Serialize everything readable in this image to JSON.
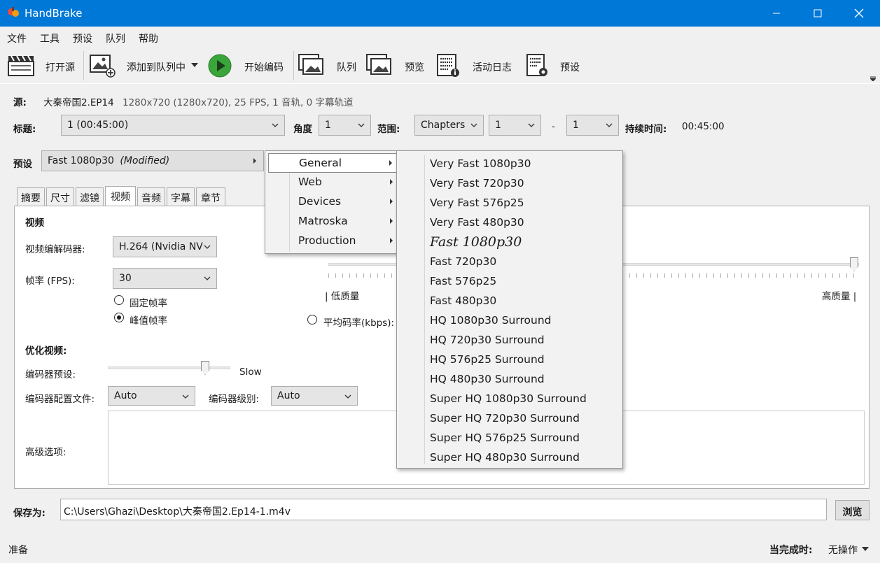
{
  "window": {
    "title": "HandBrake"
  },
  "menu": [
    "文件",
    "工具",
    "预设",
    "队列",
    "帮助"
  ],
  "toolbar": {
    "open_source": "打开源",
    "add_to_queue": "添加到队列中",
    "start_encode": "开始编码",
    "queue": "队列",
    "preview": "预览",
    "activity_log": "活动日志",
    "presets": "预设"
  },
  "source": {
    "label": "源:",
    "name": "大秦帝国2.EP14",
    "info": "1280x720 (1280x720), 25 FPS, 1 音轨, 0 字幕轨道"
  },
  "title_row": {
    "title_label": "标题:",
    "title_value": "1 (00:45:00)",
    "angle_label": "角度",
    "angle_value": "1",
    "range_label": "范围:",
    "range_type": "Chapters",
    "range_start": "1",
    "range_dash": "-",
    "range_end": "1",
    "duration_label": "持续时间:",
    "duration_value": "00:45:00"
  },
  "preset": {
    "label": "预设",
    "value": "Fast 1080p30",
    "modified": "(Modified)"
  },
  "tabs": [
    "摘要",
    "尺寸",
    "滤镜",
    "视频",
    "音频",
    "字幕",
    "章节"
  ],
  "active_tab": "视频",
  "video": {
    "section_title": "视频",
    "codec_label": "视频编解码器:",
    "codec_value": "H.264 (Nvidia NV",
    "fps_label": "帧率 (FPS):",
    "fps_value": "30",
    "constant_fr": "固定帧率",
    "peak_fr": "峰值帧率",
    "low_quality": "| 低质量",
    "high_quality": "高质量 |",
    "avg_bitrate": "平均码率(kbps):",
    "optimize_title": "优化视频:",
    "encoder_preset_label": "编码器预设:",
    "encoder_preset_value": "Slow",
    "profile_label": "编码器配置文件:",
    "profile_value": "Auto",
    "level_label": "编码器级别:",
    "level_value": "Auto",
    "advanced_label": "高级选项:"
  },
  "preset_categories": [
    {
      "label": "General"
    },
    {
      "label": "Web"
    },
    {
      "label": "Devices"
    },
    {
      "label": "Matroska"
    },
    {
      "label": "Production"
    }
  ],
  "general_presets": [
    "Very Fast 1080p30",
    "Very Fast 720p30",
    "Very Fast 576p25",
    "Very Fast 480p30",
    "Fast 1080p30",
    "Fast 720p30",
    "Fast 576p25",
    "Fast 480p30",
    "HQ 1080p30 Surround",
    "HQ 720p30 Surround",
    "HQ 576p25 Surround",
    "HQ 480p30 Surround",
    "Super HQ 1080p30 Surround",
    "Super HQ 720p30 Surround",
    "Super HQ 576p25 Surround",
    "Super HQ 480p30 Surround"
  ],
  "save": {
    "label": "保存为:",
    "path": "C:\\Users\\Ghazi\\Desktop\\大秦帝国2.Ep14-1.m4v",
    "browse": "浏览"
  },
  "status": {
    "text": "准备",
    "when_done_label": "当完成时:",
    "when_done_value": "无操作"
  }
}
